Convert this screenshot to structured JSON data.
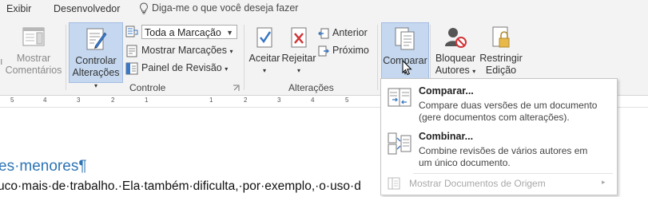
{
  "tabs": {
    "view": "Exibir",
    "developer": "Desenvolvedor"
  },
  "tellme": {
    "placeholder": "Diga-me o que você deseja fazer",
    "icon": "lightbulb-icon"
  },
  "comments": {
    "show_label_1": "Mostrar",
    "show_label_2": "Comentários"
  },
  "tracking": {
    "track_changes_1": "Controlar",
    "track_changes_2": "Alterações",
    "markup_dropdown_value": "Toda a Marcação",
    "show_markup": "Mostrar Marcações",
    "reviewing_pane": "Painel de Revisão",
    "group_label": "Controle"
  },
  "changes": {
    "accept": "Aceitar",
    "reject": "Rejeitar",
    "previous": "Anterior",
    "next": "Próximo",
    "group_label": "Alterações"
  },
  "compare": {
    "label": "Comparar"
  },
  "protect": {
    "block_authors_1": "Bloquear",
    "block_authors_2": "Autores",
    "restrict_editing_1": "Restringir",
    "restrict_editing_2": "Edição"
  },
  "compare_menu": {
    "compare_title": "Comparar...",
    "compare_desc_1": "Compare duas versões de um documento",
    "compare_desc_2": "(gere documentos com alterações).",
    "combine_title": "Combinar...",
    "combine_desc_1": "Combine revisões de vários autores em",
    "combine_desc_2": "um único documento.",
    "show_sources": "Mostrar Documentos de Origem"
  },
  "document": {
    "heading": "es·menores¶",
    "body": "uco·mais·de·trabalho.·Ela·também·dificulta,·por·exemplo,·o·uso·d"
  },
  "colors": {
    "accent": "#2e74b5",
    "selected": "#c5d8f0"
  }
}
